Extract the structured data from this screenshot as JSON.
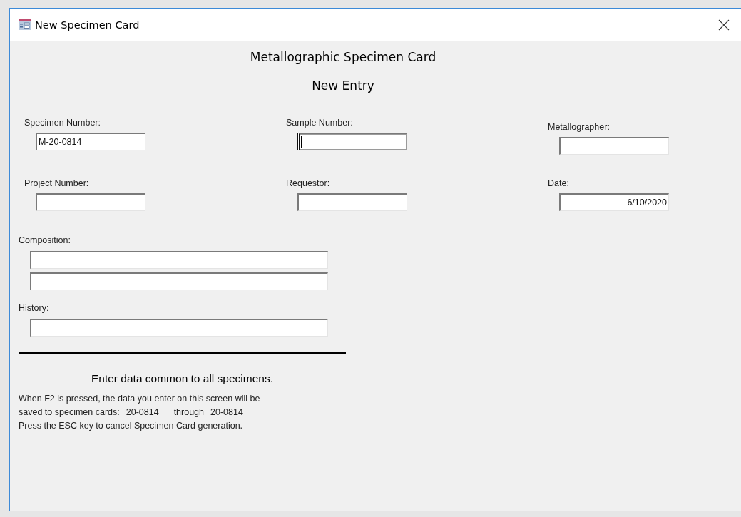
{
  "window": {
    "title": "New Specimen Card"
  },
  "form": {
    "title": "Metallographic Specimen Card",
    "subtitle": "New Entry",
    "fields": [
      {
        "label": "Specimen Number:",
        "value": "M-20-0814",
        "focused": false,
        "kind": "text"
      },
      {
        "label": "Sample Number:",
        "focused": true,
        "kind": "text"
      },
      {
        "label": "Metallographer:",
        "focused": false,
        "kind": "text"
      },
      {
        "label": "Project Number:",
        "focused": false,
        "kind": "text"
      },
      {
        "label": "Requestor:",
        "focused": false,
        "kind": "text"
      },
      {
        "label": "Date:",
        "value": "6/10/2020",
        "focused": false,
        "kind": "date"
      }
    ],
    "composition": {
      "label": "Composition:",
      "lines": [
        {
          "focused": false
        },
        {
          "focused": false
        }
      ]
    },
    "history": {
      "label": "History:",
      "lines": [
        {
          "focused": false
        }
      ]
    }
  },
  "notice": {
    "heading": "Enter data common to all specimens.",
    "line_1": "When F2 is pressed, the data you enter on this screen will be",
    "line_2": {
      "label": "saved to specimen cards:",
      "from": "20-0814",
      "through": "through",
      "to": "20-0814"
    },
    "line_3": "Press the ESC key to cancel Specimen Card generation."
  }
}
